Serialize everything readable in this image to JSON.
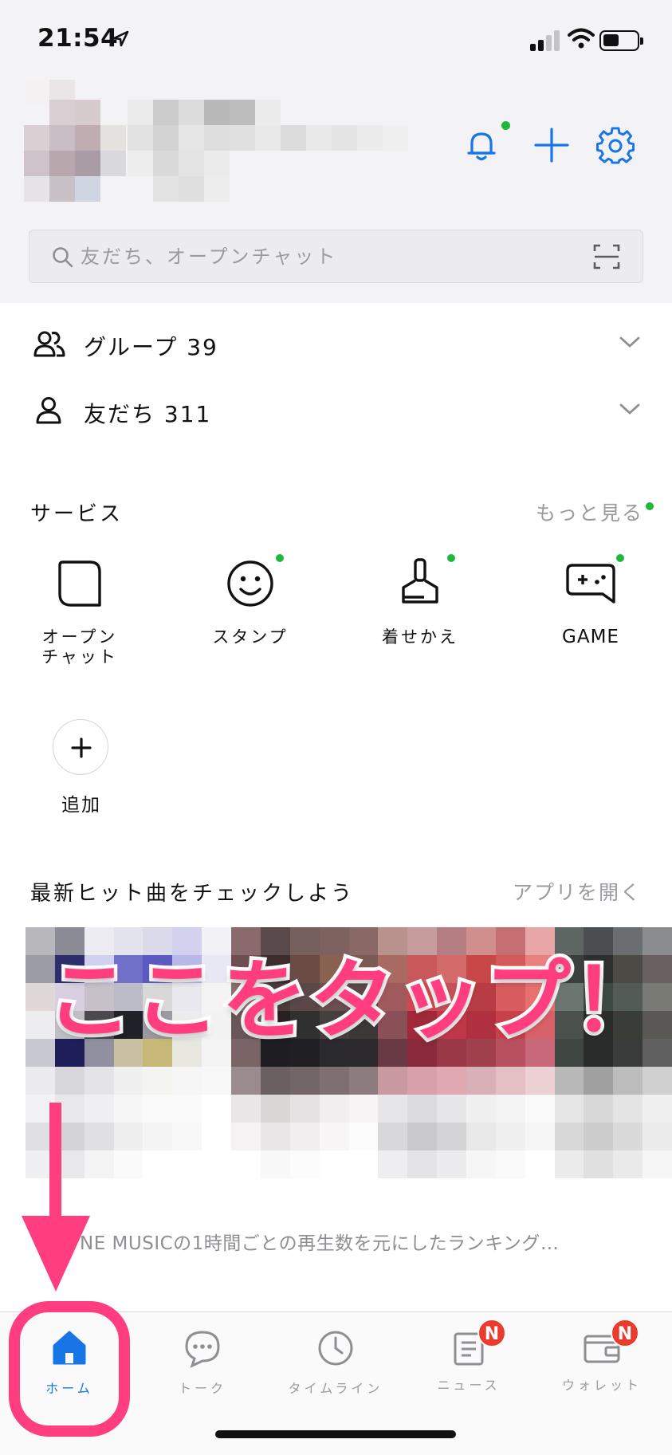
{
  "status_bar": {
    "time": "21:54"
  },
  "search": {
    "placeholder": "友だち、オープンチャット"
  },
  "lists": [
    {
      "label": "グループ 39"
    },
    {
      "label": "友だち 311"
    }
  ],
  "services": {
    "title": "サービス",
    "more_label": "もっと見る",
    "items": [
      {
        "label": "オープン\nチャット",
        "icon": "open-chat-icon"
      },
      {
        "label": "スタンプ",
        "icon": "smiley-icon"
      },
      {
        "label": "着せかえ",
        "icon": "brush-icon"
      },
      {
        "label": "GAME",
        "icon": "gamepad-icon"
      }
    ],
    "add_label": "追加"
  },
  "music": {
    "title": "最新ヒット曲をチェックしよう",
    "open_app_label": "アプリを開く",
    "caption": "NE MUSICの1時間ごとの再生数を元にしたランキング…"
  },
  "annotation": {
    "text": "ここをタップ！"
  },
  "tabs": [
    {
      "label": "ホーム",
      "icon": "home-icon",
      "active": true
    },
    {
      "label": "トーク",
      "icon": "chat-bubble-icon"
    },
    {
      "label": "タイムライン",
      "icon": "clock-icon"
    },
    {
      "label": "ニュース",
      "icon": "news-icon",
      "badge": "N"
    },
    {
      "label": "ウォレット",
      "icon": "wallet-icon",
      "badge": "N"
    }
  ],
  "colors": {
    "accent": "#1775e6",
    "annotation": "#ff3d7f",
    "badge": "#ea3b2e",
    "dot": "#1fb83a"
  }
}
